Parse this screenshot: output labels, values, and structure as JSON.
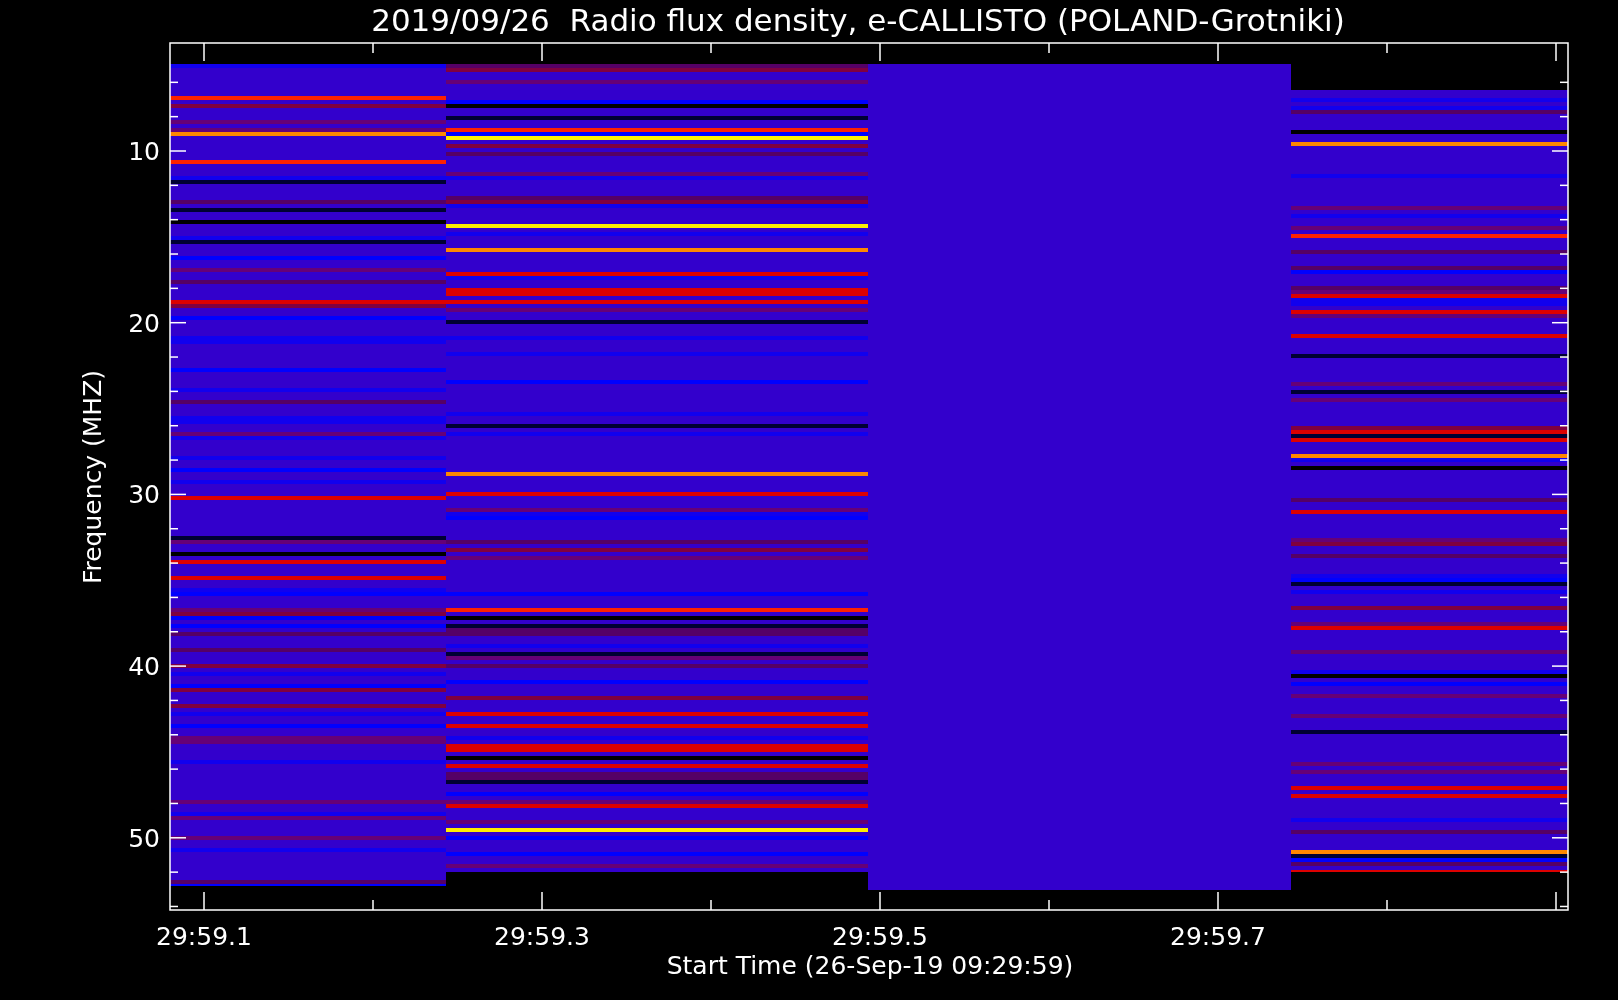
{
  "title": "2019/09/26  Radio flux density, e-CALLISTO (POLAND-Grotniki)",
  "ylabel": "Frequency (MHZ)",
  "xlabel": "Start Time (26-Sep-19 09:29:59)",
  "yticks": [
    "10",
    "20",
    "30",
    "40",
    "50"
  ],
  "xticks": [
    "29:59.1",
    "29:59.3",
    "29:59.5",
    "29:59.7"
  ]
}
